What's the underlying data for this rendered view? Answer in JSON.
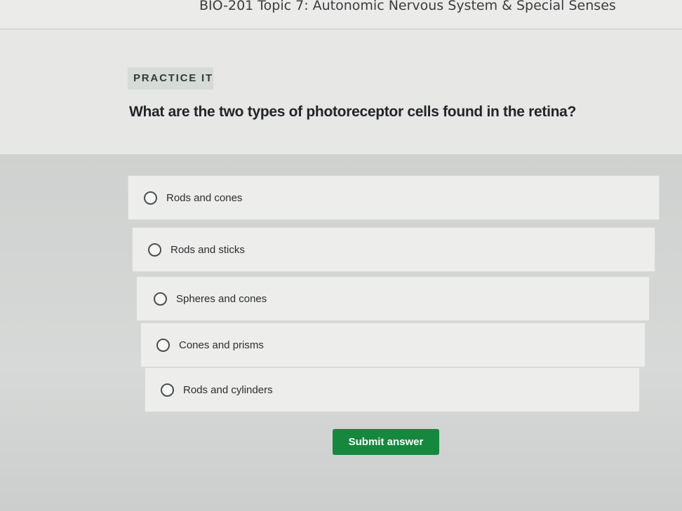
{
  "header": {
    "course_title": "BIO-201 Topic 7: Autonomic Nervous System & Special Senses"
  },
  "question": {
    "badge": "PRACTICE IT",
    "text": "What are the two types of photoreceptor cells found in the retina?"
  },
  "options": [
    {
      "label": "Rods and cones",
      "selected": false
    },
    {
      "label": "Rods and sticks",
      "selected": false
    },
    {
      "label": "Spheres and cones",
      "selected": false
    },
    {
      "label": "Cones and prisms",
      "selected": false
    },
    {
      "label": "Rods and cylinders",
      "selected": false
    }
  ],
  "actions": {
    "submit_label": "Submit answer"
  },
  "colors": {
    "submit_button": "#15883d",
    "badge_background": "#d6dbd8"
  }
}
